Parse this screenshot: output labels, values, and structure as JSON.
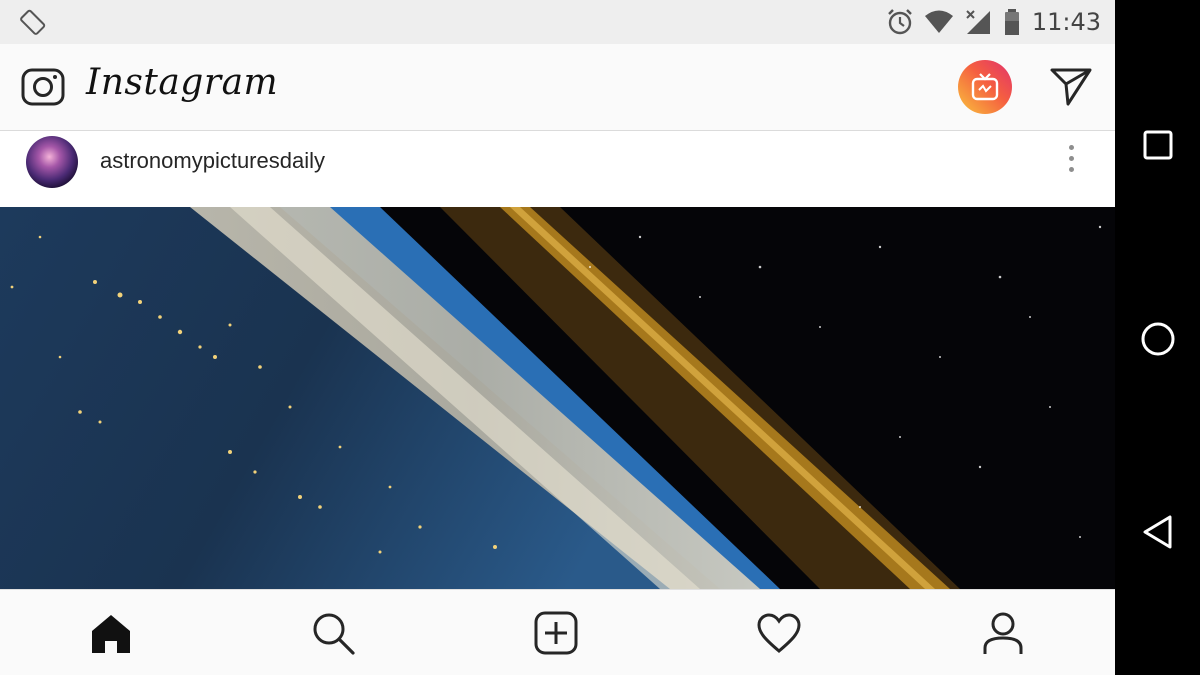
{
  "status_bar": {
    "time": "11:43",
    "icons": [
      "screen-rotation-icon",
      "alarm-icon",
      "wifi-icon",
      "signal-icon",
      "battery-icon"
    ]
  },
  "app_bar": {
    "logo_text": "Instagram",
    "icons": [
      "camera-icon",
      "igtv-icon",
      "direct-message-icon"
    ],
    "igtv_gradient": [
      "#f9c23c",
      "#f56040",
      "#e1306c"
    ]
  },
  "post": {
    "username": "astronomypicturesdaily",
    "more_icon": "more-vertical-icon",
    "media": "earth-horizon-from-orbit"
  },
  "bottom_nav": {
    "items": [
      "home-icon",
      "search-icon",
      "add-post-icon",
      "activity-heart-icon",
      "profile-icon"
    ],
    "active": "home"
  },
  "system_nav": {
    "items": [
      "recents-icon",
      "home-circle-icon",
      "back-icon"
    ]
  }
}
